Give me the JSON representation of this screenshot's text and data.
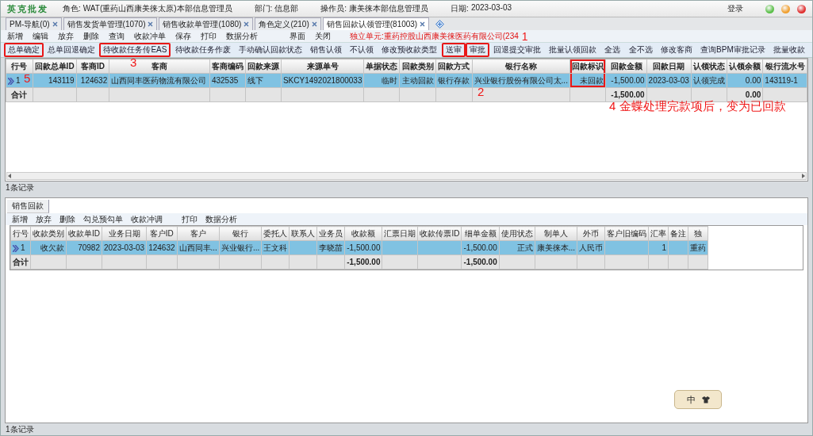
{
  "header": {
    "logo": "英克批发",
    "fields": [
      {
        "label": "角色:",
        "value": "WAT(重药山西康美徕太原)本部信息管理员"
      },
      {
        "label": "部门:",
        "value": "信息部"
      },
      {
        "label": "操作员:",
        "value": "康美徕本部信息管理员"
      },
      {
        "label": "日期:",
        "value": "2023-03-03"
      }
    ],
    "login": "登录"
  },
  "tabs": [
    {
      "label": "PM-导航(0)",
      "selected": false
    },
    {
      "label": "销售发货单管理(1070)",
      "selected": false
    },
    {
      "label": "销售收款单管理(1080)",
      "selected": false
    },
    {
      "label": "角色定义(210)",
      "selected": false
    },
    {
      "label": "销售回款认领管理(81003)",
      "selected": true
    }
  ],
  "menu": [
    "新增",
    "编辑",
    "放弃",
    "删除",
    "查询",
    "收款冲单",
    "保存",
    "打印",
    "数据分析",
    "界面",
    "关闭"
  ],
  "unit_notice": "独立单元:重药控股山西康美徕医药有限公司(234",
  "toolbar": [
    {
      "label": "总单确定",
      "highlighted": true
    },
    {
      "label": "总单回退确定",
      "highlighted": false
    },
    {
      "label": "待收款任务传EAS",
      "highlighted": true
    },
    {
      "label": "待收款任务作废",
      "highlighted": false
    },
    {
      "label": "手动确认回款状态",
      "highlighted": false
    },
    {
      "label": "销售认领",
      "highlighted": false
    },
    {
      "label": "不认领",
      "highlighted": false
    },
    {
      "label": "修改预收款类型",
      "highlighted": false
    },
    {
      "label": "送审",
      "highlighted": true
    },
    {
      "label": "审批",
      "highlighted": true
    },
    {
      "label": "回退提交审批",
      "highlighted": false
    },
    {
      "label": "批量认领回款",
      "highlighted": false
    },
    {
      "label": "全选",
      "highlighted": false
    },
    {
      "label": "全不选",
      "highlighted": false
    },
    {
      "label": "修改客商",
      "highlighted": false
    },
    {
      "label": "查询BPM审批记录",
      "highlighted": false
    },
    {
      "label": "批量收款",
      "highlighted": false
    }
  ],
  "upper_grid": {
    "rows": [
      {
        "selected": true
      }
    ],
    "columns": [
      {
        "label": "行号",
        "highlighted": false,
        "cells": [
          "1"
        ],
        "total": "合计"
      },
      {
        "label": "回款总单ID",
        "highlighted": false,
        "cells": [
          "143119"
        ]
      },
      {
        "label": "客商ID",
        "highlighted": false,
        "cells": [
          "124632"
        ]
      },
      {
        "label": "客商",
        "highlighted": false,
        "cells": [
          "山西同丰医药物流有限公司"
        ]
      },
      {
        "label": "客商编码",
        "highlighted": false,
        "cells": [
          "432535"
        ]
      },
      {
        "label": "回款来源",
        "highlighted": false,
        "cells": [
          "线下"
        ]
      },
      {
        "label": "来源单号",
        "highlighted": false,
        "cells": [
          "SKCY1492021800033"
        ]
      },
      {
        "label": "单据状态",
        "highlighted": false,
        "cells": [
          "临时"
        ]
      },
      {
        "label": "回款类别",
        "highlighted": false,
        "cells": [
          "主动回款"
        ]
      },
      {
        "label": "回款方式",
        "highlighted": false,
        "cells": [
          "银行存款"
        ]
      },
      {
        "label": "银行名称",
        "highlighted": false,
        "cells": [
          "兴业银行股份有限公司太..."
        ]
      },
      {
        "label": "回款标识",
        "highlighted": true,
        "cells": [
          "未回款"
        ]
      },
      {
        "label": "回款金额",
        "highlighted": false,
        "cells": [
          "-1,500.00"
        ],
        "total": "-1,500.00"
      },
      {
        "label": "回款日期",
        "highlighted": false,
        "cells": [
          "2023-03-03"
        ]
      },
      {
        "label": "认领状态",
        "highlighted": false,
        "cells": [
          "认领完成"
        ]
      },
      {
        "label": "认领余额",
        "highlighted": false,
        "cells": [
          "0.00"
        ],
        "total": "0.00"
      },
      {
        "label": "银行流水号",
        "highlighted": false,
        "cells": [
          "143119-1"
        ]
      }
    ],
    "status": "1条记录"
  },
  "lower_panel": {
    "tab": "销售回款",
    "menu": [
      "新增",
      "放弃",
      "删除",
      "勾兑预勾单",
      "收款冲调",
      "打印",
      "数据分析"
    ],
    "rows": [
      {
        "selected": true
      }
    ],
    "columns": [
      {
        "label": "行号",
        "cells": [
          "1"
        ],
        "total": "合计"
      },
      {
        "label": "收款类别",
        "cells": [
          "收欠款"
        ]
      },
      {
        "label": "收款单ID",
        "cells": [
          "70982"
        ]
      },
      {
        "label": "业务日期",
        "cells": [
          "2023-03-03"
        ]
      },
      {
        "label": "客户ID",
        "cells": [
          "124632"
        ]
      },
      {
        "label": "客户",
        "cells": [
          "山西同丰..."
        ]
      },
      {
        "label": "银行",
        "cells": [
          "兴业银行..."
        ]
      },
      {
        "label": "委托人",
        "cells": [
          "王文科"
        ]
      },
      {
        "label": "联系人"
      },
      {
        "label": "业务员",
        "cells": [
          "李晓苗"
        ]
      },
      {
        "label": "收款额",
        "cells": [
          "-1,500.00"
        ],
        "total": "-1,500.00"
      },
      {
        "label": "汇票日期"
      },
      {
        "label": "收款传票ID"
      },
      {
        "label": "细单金额",
        "cells": [
          "-1,500.00"
        ],
        "total": "-1,500.00"
      },
      {
        "label": "使用状态",
        "cells": [
          "正式"
        ]
      },
      {
        "label": "制单人",
        "cells": [
          "康美徕本..."
        ]
      },
      {
        "label": "外币",
        "cells": [
          "人民币"
        ]
      },
      {
        "label": "客户旧编码"
      },
      {
        "label": "汇率",
        "cells": [
          "1"
        ]
      },
      {
        "label": "备注"
      },
      {
        "label": "独",
        "cells": [
          "重药"
        ]
      }
    ],
    "status": "1条记录"
  },
  "ime_toolbar": {
    "text": "中"
  },
  "annotations": [
    {
      "text": "1"
    },
    {
      "text": "5"
    },
    {
      "text": "3"
    },
    {
      "text": "2"
    },
    {
      "text": "4 金蝶处理完款项后，变为已回款"
    }
  ]
}
